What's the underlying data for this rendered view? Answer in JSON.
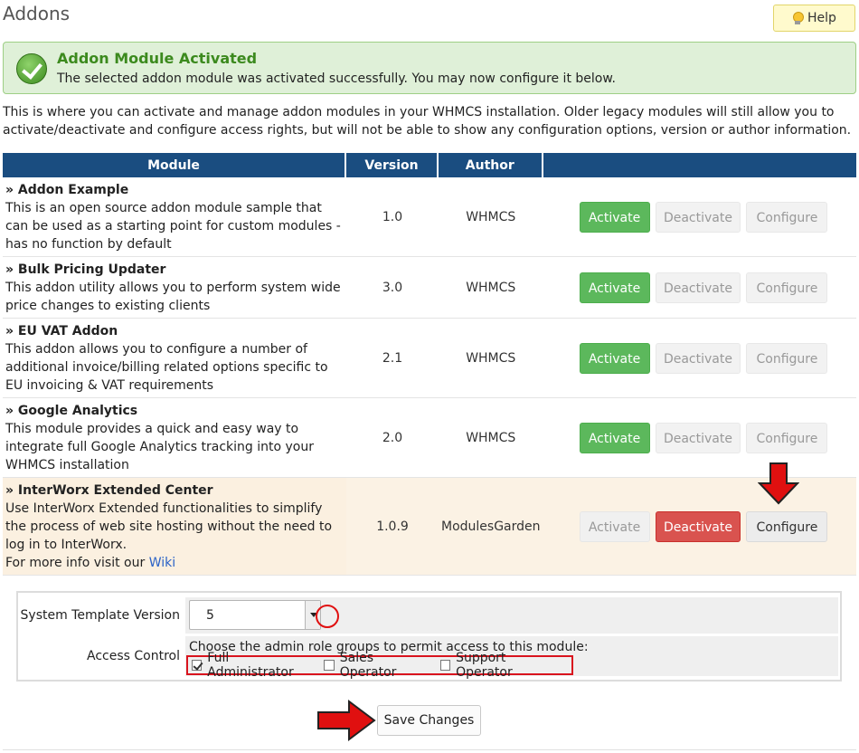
{
  "header": {
    "title": "Addons",
    "help_label": "Help"
  },
  "alert": {
    "title": "Addon Module Activated",
    "message": "The selected addon module was activated successfully. You may now configure it below."
  },
  "intro": "This is where you can activate and manage addon modules in your WHMCS installation. Older legacy modules will still allow you to activate/deactivate and configure access rights, but will not be able to show any configuration options, version or author information.",
  "table": {
    "columns": [
      "Module",
      "Version",
      "Author",
      ""
    ],
    "rows": [
      {
        "name": "» Addon Example",
        "description": "This is an open source addon module sample that can be used as a starting point for custom modules - has no function by default",
        "version": "1.0",
        "author": "WHMCS",
        "activate": "Activate",
        "deactivate": "Deactivate",
        "configure": "Configure"
      },
      {
        "name": "» Bulk Pricing Updater",
        "description": "This addon utility allows you to perform system wide price changes to existing clients",
        "version": "3.0",
        "author": "WHMCS",
        "activate": "Activate",
        "deactivate": "Deactivate",
        "configure": "Configure"
      },
      {
        "name": "» EU VAT Addon",
        "description": "This addon allows you to configure a number of additional invoice/billing related options specific to EU invoicing & VAT requirements",
        "version": "2.1",
        "author": "WHMCS",
        "activate": "Activate",
        "deactivate": "Deactivate",
        "configure": "Configure"
      },
      {
        "name": "» Google Analytics",
        "description": "This module provides a quick and easy way to integrate full Google Analytics tracking into your WHMCS installation",
        "version": "2.0",
        "author": "WHMCS",
        "activate": "Activate",
        "deactivate": "Deactivate",
        "configure": "Configure"
      },
      {
        "name": "» InterWorx Extended Center",
        "description": "Use InterWorx Extended functionalities to simplify the process of web site hosting without the need to log in to InterWorx.",
        "more_info": "For more info visit our",
        "link_text": "Wiki",
        "version": "1.0.9",
        "author": "ModulesGarden",
        "activate": "Activate",
        "deactivate": "Deactivate",
        "configure": "Configure"
      }
    ]
  },
  "config": {
    "template_label": "System Template Version",
    "template_value": "5",
    "access_label": "Access Control",
    "access_text": "Choose the admin role groups to permit access to this module:",
    "roles": [
      {
        "label": "Full Administrator",
        "checked": true
      },
      {
        "label": "Sales Operator",
        "checked": false
      },
      {
        "label": "Support Operator",
        "checked": false
      }
    ]
  },
  "save_label": "Save Changes",
  "colors": {
    "header_bg": "#1a4d80",
    "activate": "#5cb85c",
    "deactivate_active": "#d9534f",
    "annotation_red": "#e01010"
  }
}
